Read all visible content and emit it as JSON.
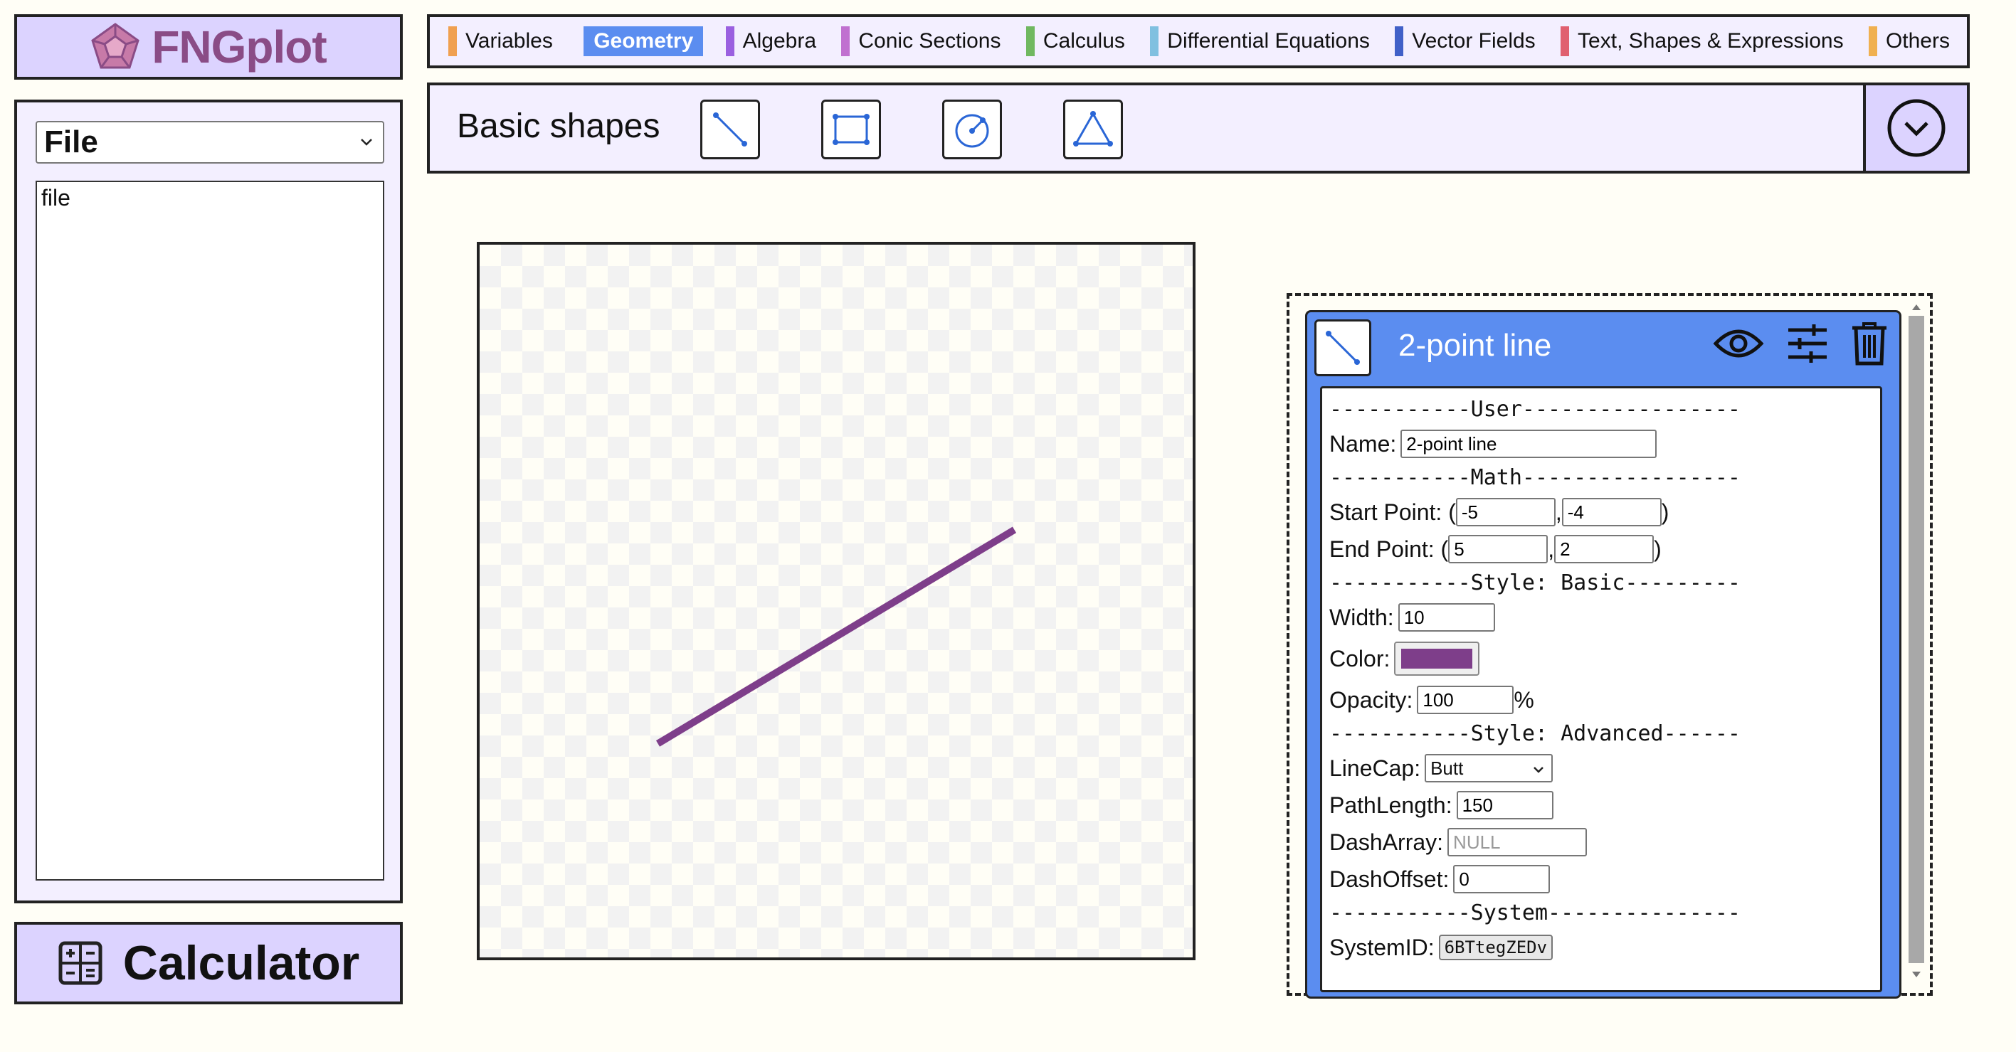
{
  "app": {
    "name": "FNGplot"
  },
  "file_panel": {
    "select_value": "File",
    "list_items": [
      "file"
    ]
  },
  "calculator": {
    "label": "Calculator"
  },
  "categories": [
    {
      "label": "Variables",
      "color": "#f0a050"
    },
    {
      "label": "Geometry",
      "color": "#5b8df0",
      "active": true
    },
    {
      "label": "Algebra",
      "color": "#9a60e0"
    },
    {
      "label": "Conic Sections",
      "color": "#c070d0"
    },
    {
      "label": "Calculus",
      "color": "#70b860"
    },
    {
      "label": "Differential Equations",
      "color": "#80c0e0"
    },
    {
      "label": "Vector Fields",
      "color": "#4060c8"
    },
    {
      "label": "Text, Shapes & Expressions",
      "color": "#e06070"
    },
    {
      "label": "Others",
      "color": "#f0b050"
    }
  ],
  "shapes_bar": {
    "title": "Basic shapes",
    "tools": [
      "line-icon",
      "rectangle-icon",
      "circle-icon",
      "triangle-icon"
    ]
  },
  "canvas": {
    "line": {
      "start": [
        -5,
        -4
      ],
      "end": [
        5,
        2
      ],
      "color": "#7e3e8a",
      "width": 10
    }
  },
  "properties": {
    "title": "2-point line",
    "sections": {
      "user": "-----------User-----------------",
      "math": "-----------Math-----------------",
      "style_basic": "-----------Style: Basic---------",
      "style_advanced": "-----------Style: Advanced------",
      "system": "-----------System---------------"
    },
    "labels": {
      "name": "Name:",
      "start_point": "Start Point: (",
      "end_point": "End Point: (",
      "comma": ",",
      "close": ")",
      "width": "Width:",
      "color": "Color:",
      "opacity": "Opacity:",
      "percent": "%",
      "linecap": "LineCap:",
      "pathlength": "PathLength:",
      "dasharray": "DashArray:",
      "dashoffset": "DashOffset:",
      "systemid": "SystemID:"
    },
    "values": {
      "name": "2-point line",
      "start_x": "-5",
      "start_y": "-4",
      "end_x": "5",
      "end_y": "2",
      "width": "10",
      "color": "#7e3e8a",
      "opacity": "100",
      "linecap": "Butt",
      "pathlength": "150",
      "dasharray_placeholder": "NULL",
      "dashoffset": "0",
      "systemid": "6BTtegZEDv"
    }
  }
}
